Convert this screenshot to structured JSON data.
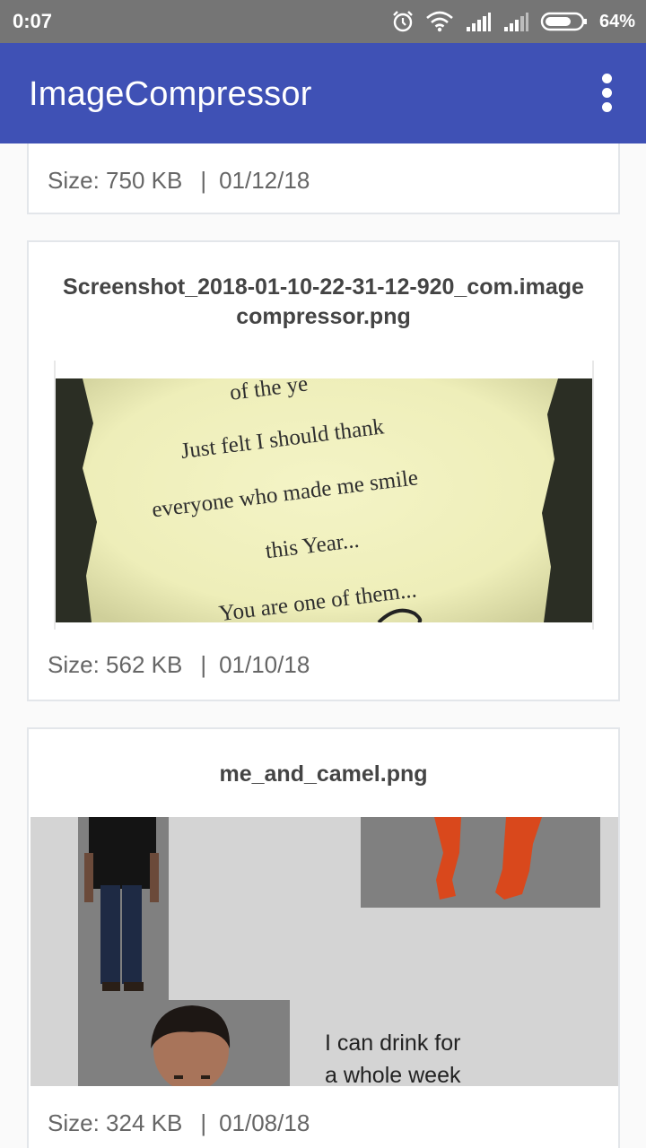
{
  "status_bar": {
    "time": "0:07",
    "battery": "64%",
    "icons": [
      "alarm-icon",
      "wifi-icon",
      "signal-icon",
      "signal-icon",
      "battery-icon"
    ]
  },
  "app_bar": {
    "title": "ImageCompressor",
    "menu_icon": "more-vertical-icon"
  },
  "cards": [
    {
      "size": "Size: 750 KB",
      "separator": "|",
      "date": "01/12/18"
    },
    {
      "title": "Screenshot_2018-01-10-22-31-12-920_com.imagecompressor.png",
      "title_line1": "Screenshot_2018-01-10-22-31-12-920_com.image",
      "title_line2": "compressor.png",
      "image_text": [
        "Just felt I should thank",
        "everyone who made me smile",
        "this Year...",
        "You are one of them..."
      ],
      "size": "Size: 562 KB",
      "separator": "|",
      "date": "01/10/18"
    },
    {
      "title": "me_and_camel.png",
      "image_caption_line1": "I can drink for",
      "image_caption_line2": "a whole week",
      "size": "Size: 324 KB",
      "separator": "|",
      "date": "01/08/18"
    }
  ],
  "colors": {
    "primary": "#3f51b5",
    "status_bar": "#757575",
    "card_border": "#e3e6ea"
  }
}
